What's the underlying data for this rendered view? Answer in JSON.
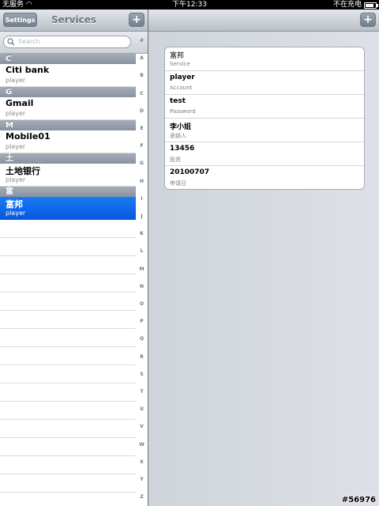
{
  "status": {
    "carrier": "无服务",
    "time": "下午12:33",
    "charging": "不在充电",
    "battery_level": 0.85
  },
  "left_nav": {
    "title": "Services",
    "settings_label": "Settings",
    "add_label": "+"
  },
  "search": {
    "placeholder": "Search"
  },
  "sections": [
    {
      "header": "C",
      "rows": [
        {
          "name": "Citi bank",
          "account": "player"
        }
      ]
    },
    {
      "header": "G",
      "rows": [
        {
          "name": "Gmail",
          "account": "player"
        }
      ]
    },
    {
      "header": "M",
      "rows": [
        {
          "name": "Mobile01",
          "account": "player"
        }
      ]
    },
    {
      "header": "土",
      "rows": [
        {
          "name": "土地银行",
          "account": "player"
        }
      ]
    },
    {
      "header": "富",
      "rows": [
        {
          "name": "富邦",
          "account": "player",
          "selected": true
        }
      ]
    }
  ],
  "index_letters": [
    "#",
    "A",
    "B",
    "C",
    "D",
    "E",
    "F",
    "G",
    "H",
    "I",
    "J",
    "K",
    "L",
    "M",
    "N",
    "O",
    "P",
    "Q",
    "R",
    "S",
    "T",
    "U",
    "V",
    "W",
    "X",
    "Y",
    "Z"
  ],
  "right_nav": {
    "add_label": "+"
  },
  "detail": [
    {
      "value": "富邦",
      "label": "Service"
    },
    {
      "value": "player",
      "label": "Account"
    },
    {
      "value": "test",
      "label": "Password"
    },
    {
      "value": "李小姐",
      "label": "承辦人"
    },
    {
      "value": "13456",
      "label": "投资"
    },
    {
      "value": "20100707",
      "label": "申请日"
    }
  ],
  "watermark": "#56976"
}
